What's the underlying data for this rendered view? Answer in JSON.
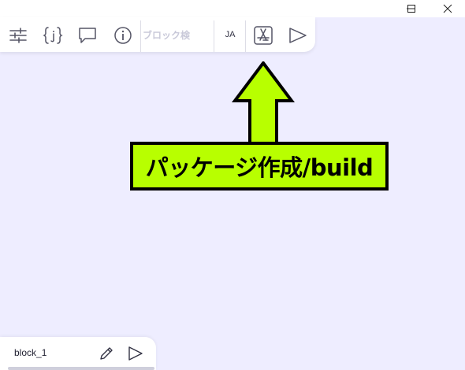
{
  "window_controls": {
    "minimize": "minimize",
    "maximize": "maximize",
    "close": "close"
  },
  "toolbar": {
    "icons": [
      "sliders-icon",
      "json-braces-icon",
      "comment-icon",
      "info-icon",
      "build-package-icon",
      "play-icon"
    ],
    "search_placeholder": "ブロック検",
    "language": "JA"
  },
  "callout": {
    "text": "パッケージ作成/build",
    "background": "#b8ff00",
    "border": "#000000"
  },
  "blockbar": {
    "block_name": "block_1",
    "icons": [
      "pencil-icon",
      "play-icon"
    ]
  },
  "colors": {
    "canvas": "#eeedff",
    "panel": "#ffffff",
    "icon": "#555566"
  }
}
